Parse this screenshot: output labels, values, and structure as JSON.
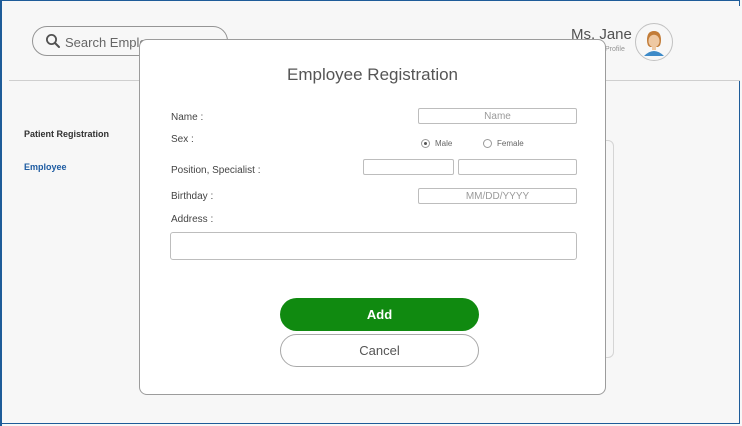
{
  "header": {
    "search_placeholder": "Search Employee",
    "user_name": "Ms. Jane",
    "user_sub": "Profile"
  },
  "sidebar": {
    "items": [
      {
        "label": "Patient Registration",
        "active": false
      },
      {
        "label": "Employee",
        "active": true
      }
    ]
  },
  "modal": {
    "title": "Employee Registration",
    "fields": {
      "name_label": "Name :",
      "name_placeholder": "Name",
      "sex_label": "Sex :",
      "sex_options": [
        "Male",
        "Female"
      ],
      "sex_selected": "Male",
      "position_label": "Position, Specialist :",
      "position_value": "",
      "specialist_value": "",
      "birthday_label": "Birthday :",
      "birthday_placeholder": "MM/DD/YYYY",
      "address_label": "Address :",
      "address_value": ""
    },
    "add_label": "Add",
    "cancel_label": "Cancel"
  },
  "colors": {
    "accent_blue": "#1f5fa8",
    "add_green": "#108a10",
    "frame_border": "#1f5f9e"
  }
}
